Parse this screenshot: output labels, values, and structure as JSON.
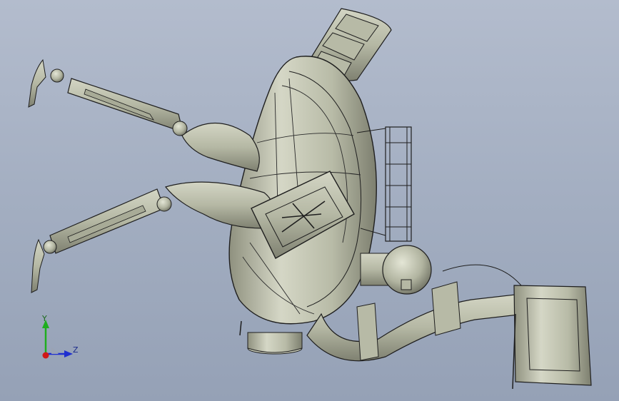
{
  "viewport": {
    "background_top": "#b3bccd",
    "background_bottom": "#95a1b6"
  },
  "model": {
    "body_color": "#c3c6b3",
    "shade_color": "#8a8c7c",
    "edge_color": "#1e1e1e"
  },
  "triad": {
    "y_label": "Y",
    "z_label": "Z",
    "y_color": "#1fae1f",
    "z_color": "#1f2fd0",
    "x_color": "#d01818"
  }
}
